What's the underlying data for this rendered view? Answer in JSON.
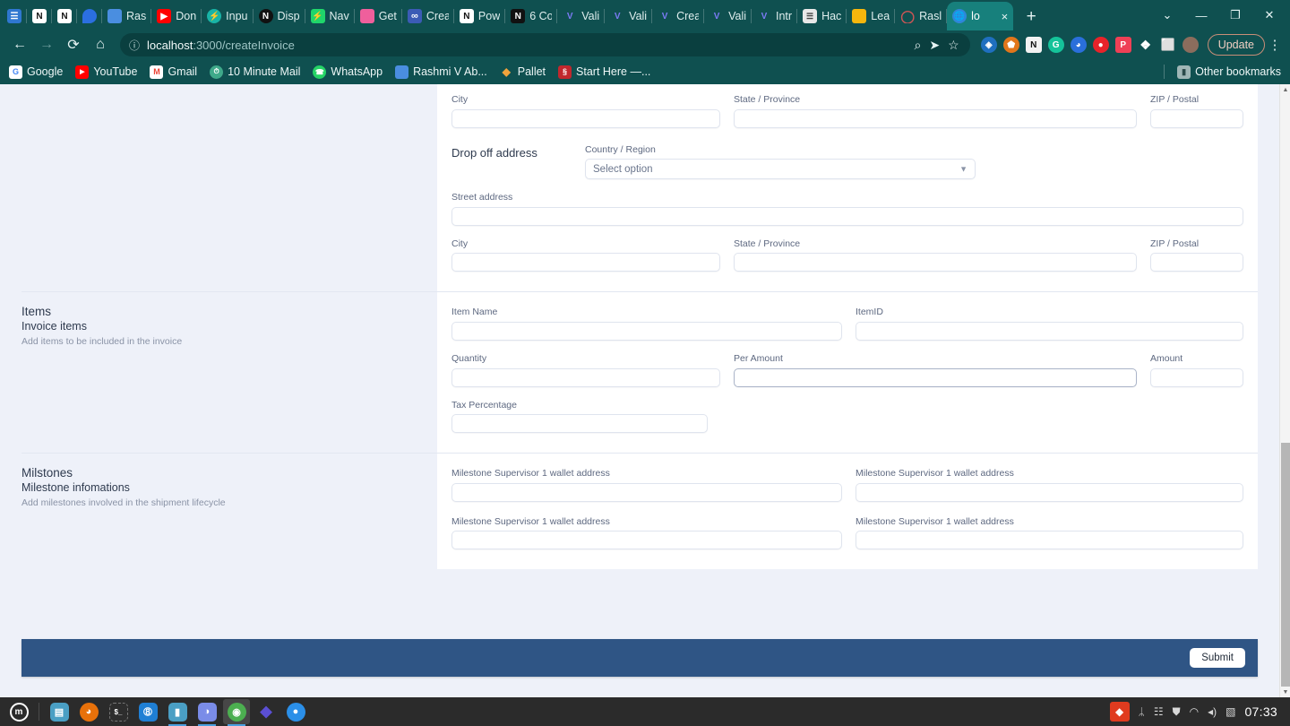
{
  "browser": {
    "tabs": [
      {
        "title": "",
        "favicon": "doc-blue-icon",
        "color": "#2f77d0",
        "glyph": "☰"
      },
      {
        "title": "",
        "favicon": "notion-icon",
        "color": "#ffffff",
        "glyph": "N"
      },
      {
        "title": "",
        "favicon": "notion-icon",
        "color": "#ffffff",
        "glyph": "N"
      },
      {
        "title": "",
        "favicon": "blue-drop-icon",
        "color": "#2b6fe0",
        "glyph": ""
      },
      {
        "title": "Ras",
        "favicon": "slides-icon",
        "color": "#4a8ee0",
        "glyph": ""
      },
      {
        "title": "Don",
        "favicon": "youtube-icon",
        "color": "#ff0000",
        "glyph": "▶"
      },
      {
        "title": "Inpu",
        "favicon": "teal-bolt-icon",
        "color": "#19b3a6",
        "glyph": "⚡"
      },
      {
        "title": "Disp",
        "favicon": "notion-dark-icon",
        "color": "#111111",
        "glyph": "N"
      },
      {
        "title": "Nav",
        "favicon": "green-bolt-icon",
        "color": "#1fd66b",
        "glyph": "⚡"
      },
      {
        "title": "Get",
        "favicon": "pink-square-icon",
        "color": "#ef5f9c",
        "glyph": ""
      },
      {
        "title": "Crea",
        "favicon": "infinity-icon",
        "color": "#3b5bb5",
        "glyph": "∞"
      },
      {
        "title": "Pow",
        "favicon": "notion-icon",
        "color": "#ffffff",
        "glyph": "N"
      },
      {
        "title": "6 Co",
        "favicon": "notion-dark-icon",
        "color": "#111111",
        "glyph": "N"
      },
      {
        "title": "Vali",
        "favicon": "v-logo-icon",
        "color": "#6b6bef",
        "glyph": "V"
      },
      {
        "title": "Vali",
        "favicon": "v-logo-icon",
        "color": "#6b6bef",
        "glyph": "V"
      },
      {
        "title": "Crea",
        "favicon": "v-logo-icon",
        "color": "#6b6bef",
        "glyph": "V"
      },
      {
        "title": "Vali",
        "favicon": "v-logo-icon",
        "color": "#6b6bef",
        "glyph": "V"
      },
      {
        "title": "Intr",
        "favicon": "v-logo-icon",
        "color": "#6b6bef",
        "glyph": "V"
      },
      {
        "title": "Hac",
        "favicon": "page-icon",
        "color": "#e8e8e8",
        "glyph": "☰"
      },
      {
        "title": "Lea",
        "favicon": "yellow-square-icon",
        "color": "#f5b60d",
        "glyph": ""
      },
      {
        "title": "Rasl",
        "favicon": "red-circle-icon",
        "color": "#cc3333",
        "glyph": "○"
      }
    ],
    "active_tab": {
      "title": "lo",
      "favicon": "globe-icon",
      "close_label": "×"
    },
    "newtab_label": "+",
    "window_controls": {
      "tablist": "⌄",
      "minimize": "—",
      "maximize": "❐",
      "close": "✕"
    },
    "toolbar": {
      "back": "←",
      "forward": "→",
      "reload": "⟳",
      "home": "⌂",
      "site_info": "ⓘ",
      "url_host": "localhost",
      "url_path": ":3000/createInvoice",
      "zoom_icon": "⌕",
      "share_icon": "➤",
      "bookmark_icon": "☆",
      "extensions": [
        {
          "name": "dropbox-extension",
          "color": "#1f6fbf",
          "glyph": "◈"
        },
        {
          "name": "metamask-extension",
          "color": "#e2761b",
          "glyph": "⬟"
        },
        {
          "name": "notion-extension",
          "color": "#f2f2f2",
          "glyph": "N"
        },
        {
          "name": "grammarly-extension",
          "color": "#15c39a",
          "glyph": "G"
        },
        {
          "name": "chrome-profile-extension",
          "color": "#2a6fdb",
          "glyph": "◕"
        },
        {
          "name": "opera-extension",
          "color": "#e8232a",
          "glyph": "●"
        },
        {
          "name": "pocket-extension",
          "color": "#ef4056",
          "glyph": "P"
        },
        {
          "name": "puzzle-extensions-icon",
          "color": "transparent",
          "glyph": "❖"
        },
        {
          "name": "side-panel-icon",
          "color": "transparent",
          "glyph": "⬜"
        },
        {
          "name": "avatar",
          "color": "#8c6d5d",
          "glyph": ""
        }
      ],
      "update_label": "Update",
      "menu_icon": "⋮"
    },
    "bookmarks": [
      {
        "label": "Google",
        "icon": "google-icon",
        "color": "#ffffff",
        "glyph": "G"
      },
      {
        "label": "YouTube",
        "icon": "youtube-icon",
        "color": "#ff0000",
        "glyph": "▶"
      },
      {
        "label": "Gmail",
        "icon": "gmail-icon",
        "color": "#ffffff",
        "glyph": "M"
      },
      {
        "label": "10 Minute Mail",
        "icon": "tenminutemail-icon",
        "color": "#3fa98a",
        "glyph": "⏱"
      },
      {
        "label": "WhatsApp",
        "icon": "whatsapp-icon",
        "color": "#25d366",
        "glyph": "✆"
      },
      {
        "label": "Rashmi V Ab...",
        "icon": "slides-icon",
        "color": "#4a8ee0",
        "glyph": ""
      },
      {
        "label": "Pallet",
        "icon": "pallet-icon",
        "color": "#f0a33c",
        "glyph": "◆"
      },
      {
        "label": "Start Here —...",
        "icon": "startthere-icon",
        "color": "#c1272d",
        "glyph": "§"
      }
    ],
    "other_bookmarks": {
      "label": "Other bookmarks",
      "icon": "folder-icon",
      "glyph": "▰"
    }
  },
  "page": {
    "pickup": {
      "street_value": "",
      "city_label": "City",
      "state_label": "State / Province",
      "zip_label": "ZIP / Postal"
    },
    "dropoff": {
      "title": "Drop off address",
      "country_label": "Country / Region",
      "country_value": "Select option",
      "country_options": [
        "Select option"
      ],
      "street_label": "Street address",
      "city_label": "City",
      "state_label": "State / Province",
      "zip_label": "ZIP / Postal"
    },
    "items": {
      "section_title": "Items",
      "subtitle": "Invoice items",
      "description": "Add items to be included in the invoice",
      "item_name_label": "Item Name",
      "item_id_label": "ItemID",
      "quantity_label": "Quantity",
      "per_amount_label": "Per Amount",
      "amount_label": "Amount",
      "tax_label": "Tax Percentage"
    },
    "milestones": {
      "section_title": "Milstones",
      "subtitle": "Milestone infomations",
      "description": "Add milestones involved in the shipment lifecycle",
      "fields": [
        "Milestone Supervisor 1 wallet address",
        "Milestone Supervisor 1 wallet address",
        "Milestone Supervisor 1 wallet address",
        "Milestone Supervisor 1 wallet address"
      ]
    },
    "footer": {
      "submit_label": "Submit",
      "bar_color": "#2f5585"
    },
    "scrollbar": {
      "up": "▲",
      "down": "▼"
    }
  },
  "taskbar": {
    "menu": {
      "name": "mint-menu-icon",
      "glyph": "Ⓜ"
    },
    "items": [
      {
        "name": "files-window-icon",
        "color": "#4a9fc4",
        "glyph": "▤"
      },
      {
        "name": "firefox-icon",
        "color": "#e8710a",
        "glyph": "◕"
      },
      {
        "name": "terminal-icon",
        "color": "#2d2d2d",
        "glyph": "$_"
      },
      {
        "name": "vscode-icon",
        "color": "#1f7fd4",
        "glyph": "⎇"
      },
      {
        "name": "file-manager-icon",
        "color": "#4a9fc4",
        "glyph": "▰"
      },
      {
        "name": "discord-icon",
        "color": "#7a8ce8",
        "glyph": "◑"
      },
      {
        "name": "chrome-icon",
        "color": "#4caf50",
        "glyph": "◉"
      },
      {
        "name": "brave-icon",
        "color": "#5b4fd4",
        "glyph": "◆"
      },
      {
        "name": "location-icon",
        "color": "#2b8fe8",
        "glyph": "●"
      }
    ],
    "tray": [
      {
        "name": "nvidia-icon",
        "glyph": "◆"
      },
      {
        "name": "bluetooth-icon",
        "glyph": "ᛦ"
      },
      {
        "name": "clipboard-icon",
        "glyph": "☷"
      },
      {
        "name": "shield-update-icon",
        "glyph": "⛊"
      },
      {
        "name": "wifi-icon",
        "glyph": "◠"
      },
      {
        "name": "volume-icon",
        "glyph": "◂)"
      },
      {
        "name": "battery-icon",
        "glyph": "▧"
      }
    ],
    "clock": "07:33"
  }
}
